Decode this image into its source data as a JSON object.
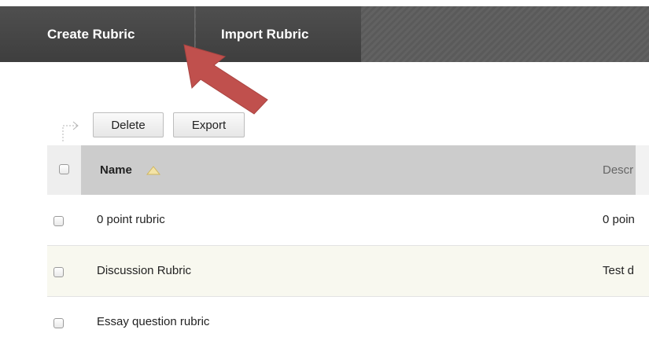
{
  "action_bar": {
    "create_rubric": "Create Rubric",
    "import_rubric": "Import Rubric"
  },
  "toolbar": {
    "delete_label": "Delete",
    "export_label": "Export"
  },
  "table": {
    "columns": {
      "name": "Name",
      "description": "Descr"
    },
    "rows": [
      {
        "name": "0 point rubric",
        "description": "0 poin"
      },
      {
        "name": "Discussion Rubric",
        "description": "Test d"
      },
      {
        "name": "Essay question rubric",
        "description": ""
      }
    ]
  },
  "colors": {
    "action_bar": "#4a4a4a",
    "arrow": "#c0504d",
    "header_row": "#cccccc",
    "alt_row": "#f8f8ef"
  }
}
